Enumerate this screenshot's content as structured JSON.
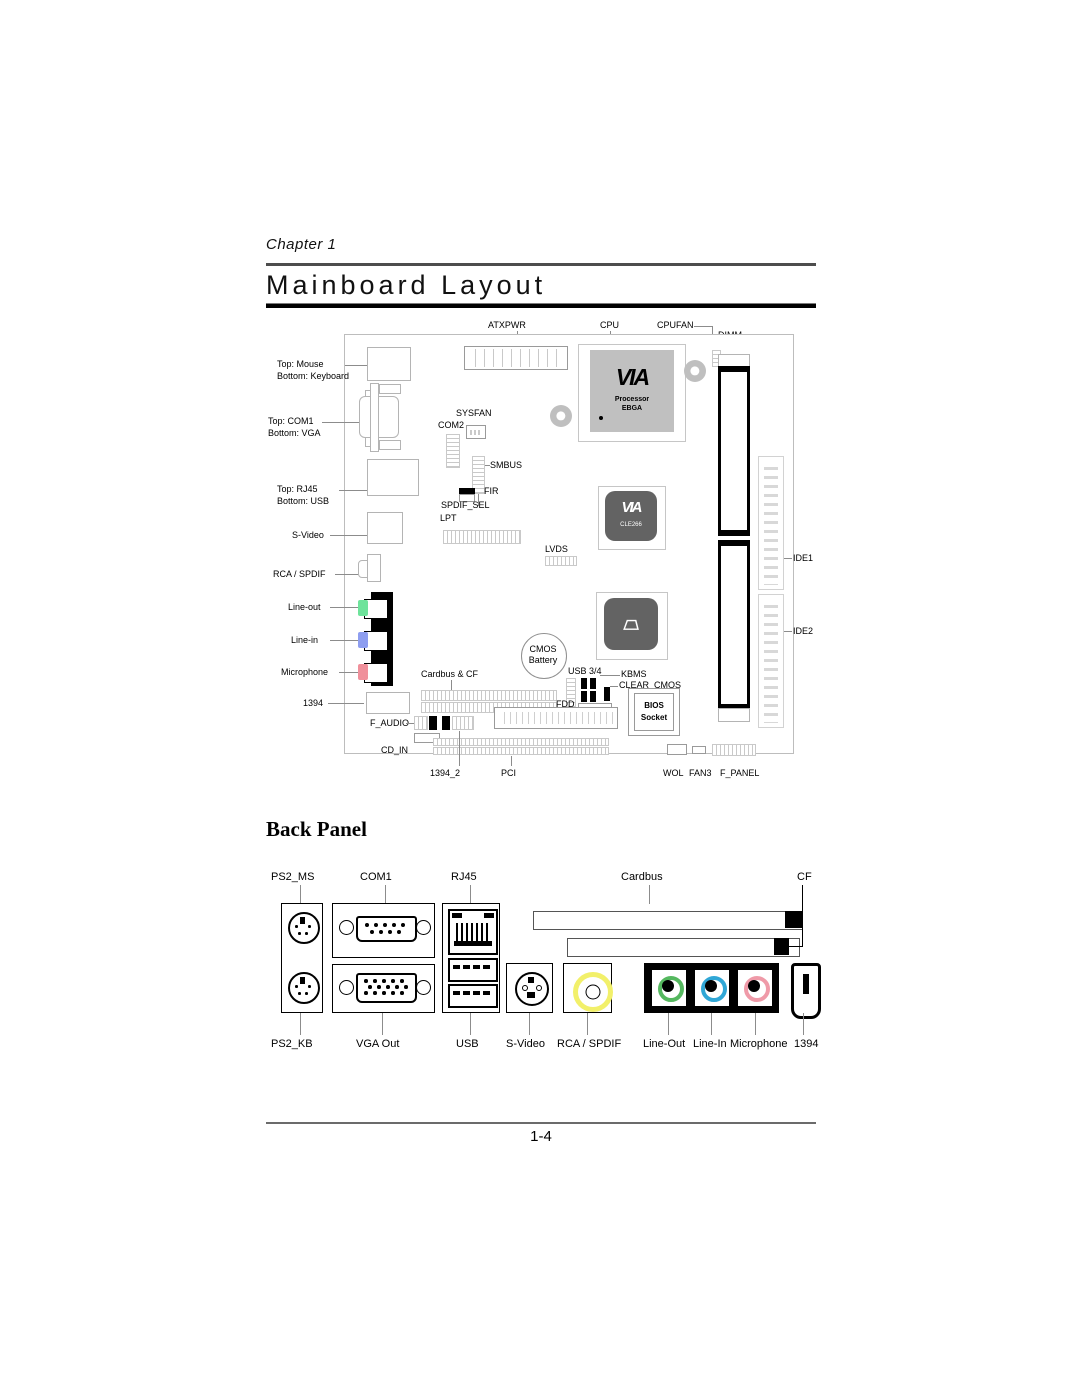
{
  "header": {
    "chapter": "Chapter 1",
    "title": "Mainboard Layout"
  },
  "sections": {
    "back_panel_title": "Back Panel"
  },
  "footer": {
    "page_number": "1-4"
  },
  "layout_diagram": {
    "top_labels": [
      "ATXPWR",
      "CPU",
      "CPUFAN",
      "DIMM"
    ],
    "left_labels": [
      "Top:  Mouse",
      "Bottom: Keyboard",
      "Top:  COM1",
      "Bottom: VGA",
      "Top:  RJ45",
      "Bottom: USB",
      "S-Video",
      "RCA / SPDIF",
      "Line-out",
      "Line-in",
      "Microphone",
      "1394"
    ],
    "inner_labels": [
      "SYSFAN",
      "COM2",
      "SMBUS",
      "FIR",
      "SPDIF_SEL",
      "LPT",
      "LVDS",
      "CMOS",
      "Battery",
      "Cardbus & CF",
      "USB 3/4",
      "KBMS",
      "CLEAR_CMOS",
      "FDD",
      "BIOS",
      "Socket",
      "F_AUDIO",
      "CD_IN"
    ],
    "bottom_labels": [
      "1394_2",
      "PCI",
      "WOL",
      "FAN3",
      "F_PANEL"
    ],
    "right_labels": [
      "IDE1",
      "IDE2"
    ],
    "chips": {
      "cpu_brand": "VIA",
      "cpu_line1": "Processor",
      "cpu_line2": "EBGA",
      "north_brand": "VIA",
      "north_part": "CLE266"
    },
    "audio_colors": {
      "line_out": "#6ee39b",
      "line_in": "#8e9ef0",
      "microphone": "#f0909b"
    }
  },
  "back_panel": {
    "top_labels": [
      "PS2_MS",
      "COM1",
      "RJ45",
      "Cardbus",
      "CF"
    ],
    "bottom_labels": [
      "PS2_KB",
      "VGA Out",
      "USB",
      "S-Video",
      "RCA / SPDIF",
      "Line-Out",
      "Line-In",
      "Microphone",
      "1394"
    ],
    "jack_colors": {
      "line_out": "#55b85f",
      "line_in": "#30a7d6",
      "microphone": "#ef9aa8",
      "rca": "#f2f06a"
    }
  }
}
